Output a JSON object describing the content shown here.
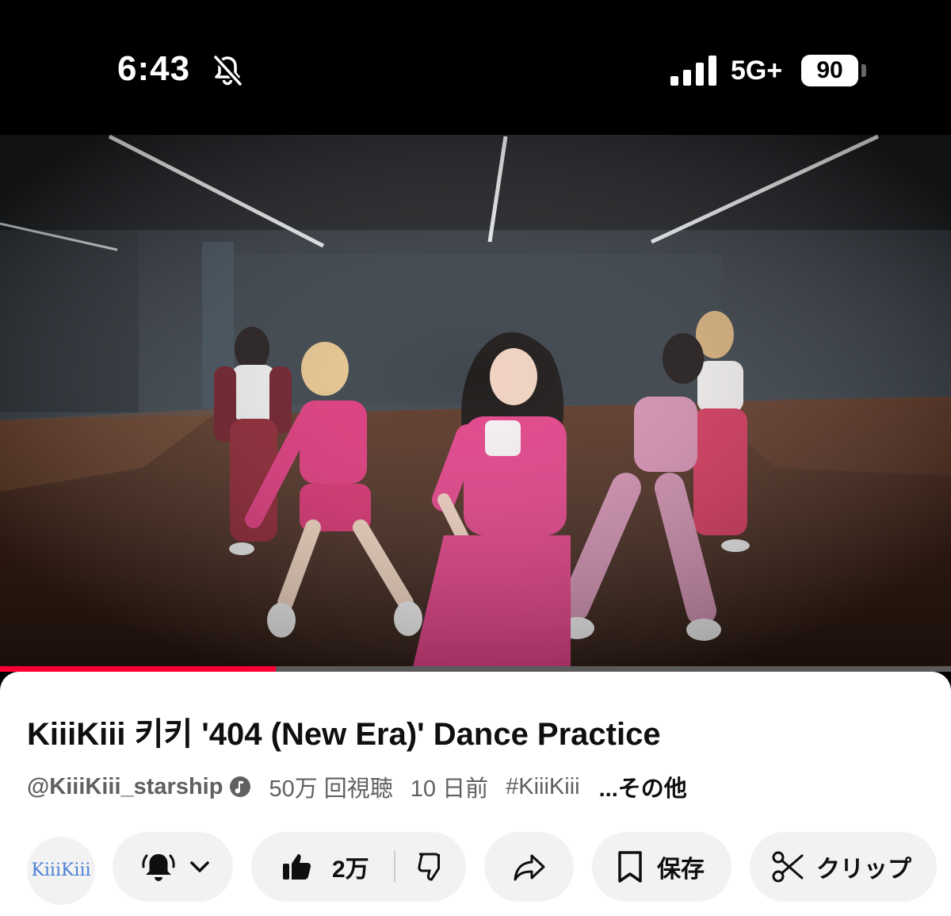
{
  "status_bar": {
    "time": "6:43",
    "network": "5G+",
    "battery": "90",
    "icons": [
      "bell-slash-icon",
      "signal-icon",
      "battery-icon"
    ]
  },
  "video": {
    "progress_fraction": 0.29,
    "progress_color": "#ff0033"
  },
  "video_info": {
    "title": "KiiiKiii 키키 '404 (New Era)' Dance Practice",
    "channel": "@KiiiKiii_starship",
    "views": "50万 回視聴",
    "age": "10 日前",
    "hashtag": "#KiiiKiii",
    "more": "...その他"
  },
  "actions": {
    "avatar_label": "KiiiKiii",
    "like_count": "2万",
    "save_label": "保存",
    "clip_label": "クリップ"
  },
  "colors": {
    "accent": "#ff0033",
    "pill_bg": "#f2f2f2",
    "text_primary": "#0f0f0f",
    "text_secondary": "#606060"
  }
}
